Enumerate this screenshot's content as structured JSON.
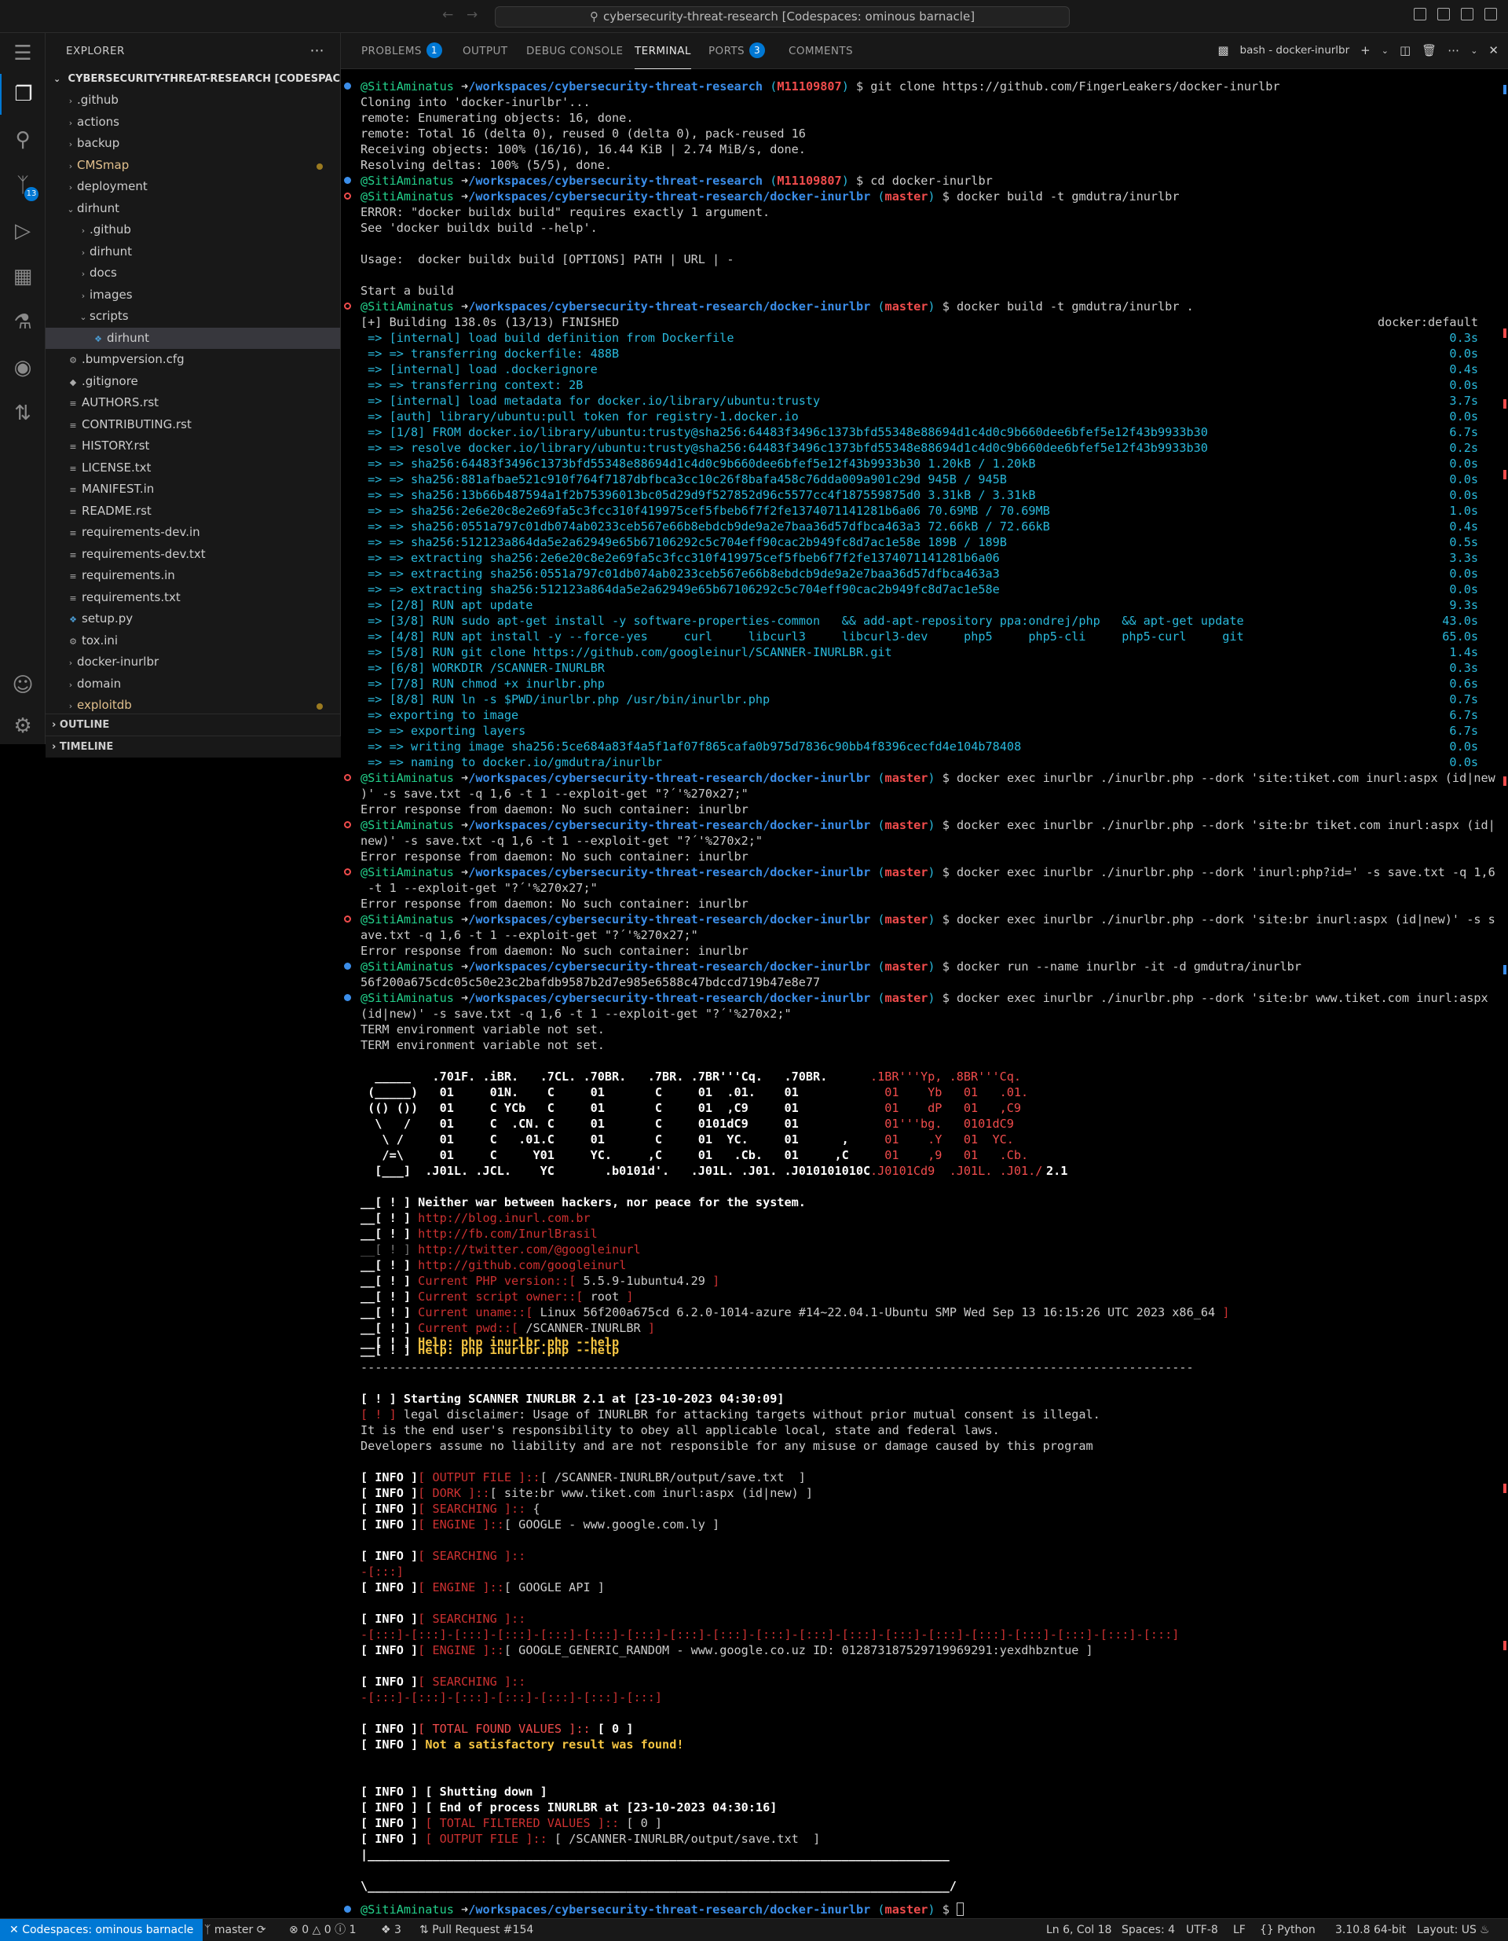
{
  "titlebar": {
    "search_text": "cybersecurity-threat-research [Codespaces: ominous barnacle]"
  },
  "activity": {
    "scm_badge": "13"
  },
  "explorer": {
    "header": "EXPLORER",
    "repo": "CYBERSECURITY-THREAT-RESEARCH [CODESPACES: OMINOUS BARNACLE]",
    "rows": [
      ".github",
      "actions",
      "backup",
      "CMSmap",
      "deployment",
      "dirhunt",
      ".github",
      "dirhunt",
      "docs",
      "images",
      "scripts",
      "dirhunt",
      ".bumpversion.cfg",
      ".gitignore",
      "AUTHORS.rst",
      "CONTRIBUTING.rst",
      "HISTORY.rst",
      "LICENSE.txt",
      "MANIFEST.in",
      "README.rst",
      "requirements-dev.in",
      "requirements-dev.txt",
      "requirements.in",
      "requirements.txt",
      "setup.py",
      "tox.ini",
      "docker-inurlbr",
      "domain",
      "exploitdb"
    ],
    "outline": "OUTLINE",
    "timeline": "TIMELINE"
  },
  "panel": {
    "tabs": [
      "PROBLEMS",
      "OUTPUT",
      "DEBUG CONSOLE",
      "TERMINAL",
      "PORTS",
      "COMMENTS"
    ],
    "problems_badge": "1",
    "ports_badge": "3",
    "terminal_name": "bash - docker-inurlbr"
  },
  "terminal": {
    "user": "@SitiAminatus",
    "arrow": "➜",
    "path_root": "/workspaces/cybersecurity-threat-research",
    "path_docker": "/workspaces/cybersecurity-threat-research/docker-inurlbr",
    "branch_main": "M11109807",
    "branch_master": "master",
    "cmd_clone": "$ git clone https://github.com/FingerLeakers/docker-inurlbr",
    "clone_out": [
      "Cloning into 'docker-inurlbr'...",
      "remote: Enumerating objects: 16, done.",
      "remote: Total 16 (delta 0), reused 0 (delta 0), pack-reused 16",
      "Receiving objects: 100% (16/16), 16.44 KiB | 2.74 MiB/s, done.",
      "Resolving deltas: 100% (5/5), done."
    ],
    "cmd_cd": "$ cd docker-inurlbr",
    "cmd_build1": "$ docker build -t gmdutra/inurlbr",
    "build1_out": [
      "ERROR: \"docker buildx build\" requires exactly 1 argument.",
      "See 'docker buildx build --help'.",
      "",
      "Usage:  docker buildx build [OPTIONS] PATH | URL | -",
      "",
      "Start a build"
    ],
    "cmd_build2": "$ docker build -t gmdutra/inurlbr .",
    "build_header": "[+] Building 138.0s (13/13) FINISHED",
    "build_ctx": "docker:default",
    "build_steps": [
      [
        " => [internal] load build definition from Dockerfile",
        "0.3s"
      ],
      [
        " => => transferring dockerfile: 488B",
        "0.0s"
      ],
      [
        " => [internal] load .dockerignore",
        "0.4s"
      ],
      [
        " => => transferring context: 2B",
        "0.0s"
      ],
      [
        " => [internal] load metadata for docker.io/library/ubuntu:trusty",
        "3.7s"
      ],
      [
        " => [auth] library/ubuntu:pull token for registry-1.docker.io",
        "0.0s"
      ],
      [
        " => [1/8] FROM docker.io/library/ubuntu:trusty@sha256:64483f3496c1373bfd55348e88694d1c4d0c9b660dee6bfef5e12f43b9933b30",
        "6.7s"
      ],
      [
        " => => resolve docker.io/library/ubuntu:trusty@sha256:64483f3496c1373bfd55348e88694d1c4d0c9b660dee6bfef5e12f43b9933b30",
        "0.2s"
      ],
      [
        " => => sha256:64483f3496c1373bfd55348e88694d1c4d0c9b660dee6bfef5e12f43b9933b30 1.20kB / 1.20kB",
        "0.0s"
      ],
      [
        " => => sha256:881afbae521c910f764f7187dbfbca3cc10c26f8bafa458c76dda009a901c29d 945B / 945B",
        "0.0s"
      ],
      [
        " => => sha256:13b66b487594a1f2b75396013bc05d29d9f527852d96c5577cc4f187559875d0 3.31kB / 3.31kB",
        "0.0s"
      ],
      [
        " => => sha256:2e6e20c8e2e69fa5c3fcc310f419975cef5fbeb6f7f2fe1374071141281b6a06 70.69MB / 70.69MB",
        "1.0s"
      ],
      [
        " => => sha256:0551a797c01db074ab0233ceb567e66b8ebdcb9de9a2e7baa36d57dfbca463a3 72.66kB / 72.66kB",
        "0.4s"
      ],
      [
        " => => sha256:512123a864da5e2a62949e65b67106292c5c704eff90cac2b949fc8d7ac1e58e 189B / 189B",
        "0.5s"
      ],
      [
        " => => extracting sha256:2e6e20c8e2e69fa5c3fcc310f419975cef5fbeb6f7f2fe1374071141281b6a06",
        "3.3s"
      ],
      [
        " => => extracting sha256:0551a797c01db074ab0233ceb567e66b8ebdcb9de9a2e7baa36d57dfbca463a3",
        "0.0s"
      ],
      [
        " => => extracting sha256:512123a864da5e2a62949e65b67106292c5c704eff90cac2b949fc8d7ac1e58e",
        "0.0s"
      ],
      [
        " => [2/8] RUN apt update",
        "9.3s"
      ],
      [
        " => [3/8] RUN sudo apt-get install -y software-properties-common   && add-apt-repository ppa:ondrej/php   && apt-get update",
        "43.0s"
      ],
      [
        " => [4/8] RUN apt install -y --force-yes     curl     libcurl3     libcurl3-dev     php5     php5-cli     php5-curl     git",
        "65.0s"
      ],
      [
        " => [5/8] RUN git clone https://github.com/googleinurl/SCANNER-INURLBR.git",
        "1.4s"
      ],
      [
        " => [6/8] WORKDIR /SCANNER-INURLBR",
        "0.3s"
      ],
      [
        " => [7/8] RUN chmod +x inurlbr.php",
        "0.6s"
      ],
      [
        " => [8/8] RUN ln -s $PWD/inurlbr.php /usr/bin/inurlbr.php",
        "0.7s"
      ],
      [
        " => exporting to image",
        "6.7s"
      ],
      [
        " => => exporting layers",
        "6.7s"
      ],
      [
        " => => writing image sha256:5ce684a83f4a5f1af07f865cafa0b975d7836c90bb4f8396cecfd4e104b78408",
        "0.0s"
      ],
      [
        " => => naming to docker.io/gmdutra/inurlbr",
        "0.0s"
      ]
    ],
    "exec1_a": "$ docker exec inurlbr ./inurlbr.php --dork 'site:tiket.com inurl:aspx (id|new",
    "exec1_b": ")' -s save.txt -q 1,6 -t 1 --exploit-get \"?´'%270x27;\"",
    "err": "Error response from daemon: No such container: inurlbr",
    "exec2_a": "$ docker exec inurlbr ./inurlbr.php --dork 'site:br tiket.com inurl:aspx (id|",
    "exec2_b": "new)' -s save.txt -q 1,6 -t 1 --exploit-get \"?´'%270x2;\"",
    "exec3_a": "$ docker exec inurlbr ./inurlbr.php --dork 'inurl:php?id=' -s save.txt -q 1,6",
    "exec3_b": " -t 1 --exploit-get \"?´'%270x27;\"",
    "exec4_a": "$ docker exec inurlbr ./inurlbr.php --dork 'site:br inurl:aspx (id|new)' -s s",
    "exec4_b": "ave.txt -q 1,6 -t 1 --exploit-get \"?´'%270x27;\"",
    "run_cmd": "$ docker run --name inurlbr -it -d gmdutra/inurlbr",
    "run_out": "56f200a675cdc05c50e23c2bafdb9587b2d7e985e6588c47bdccd719b47e8e77",
    "exec5_a": "$ docker exec inurlbr ./inurlbr.php --dork 'site:br www.tiket.com inurl:aspx",
    "exec5_b": "(id|new)' -s save.txt -q 1,6 -t 1 --exploit-get \"?´'%270x2;\"",
    "term_warn": "TERM environment variable not set.",
    "banner_white": [
      "  _____   .701F. .iBR.   .7CL. .70BR.   .7BR. .7BR'''Cq.   .70BR.",
      " (_____)   01     01N.    C     01       C     01  .01.    01",
      " (() ())   01     C YCb   C     01       C     01  ,C9     01",
      "  \\   /    01     C  .CN. C     01       C     0101dC9     01",
      "   \\ /     01     C   .01.C     01       C     01  YC.     01      ,",
      "   /=\\     01     C     Y01     YC.     ,C     01   .Cb.   01     ,C",
      "  [___]  .J01L. .JCL.    YC       .b0101d'.   .J01L. .J01. .J010101010C"
    ],
    "banner_red": [
      ".1BR'''Yp, .8BR'''Cq.",
      "  01    Yb   01   .01.",
      "  01    dP   01   ,C9",
      "  01'''bg.   0101dC9",
      "  01    .Y   01  YC.",
      "  01    ,9   01   .Cb.",
      ".J0101Cd9  .J01L. .J01./"
    ],
    "banner_ver": "2.1",
    "tag": "__[ ! ]",
    "slogan": "Neither war between hackers, nor peace for the system.",
    "links": [
      "http://blog.inurl.com.br",
      "http://fb.com/InurlBrasil",
      "http://twitter.com/@googleinurl",
      "http://github.com/googleinurl"
    ],
    "php_label": "Current PHP version::[",
    "php_val": "5.5.9-1ubuntu4.29",
    "owner_label": "Current script owner::[",
    "owner_val": "root",
    "uname_label": "Current uname::[",
    "uname_val": "Linux 56f200a675cd 6.2.0-1014-azure #14~22.04.1-Ubuntu SMP Wed Sep 13 16:15:26 UTC 2023 x86_64",
    "pwd_label": "Current pwd::[",
    "pwd_val": "/SCANNER-INURLBR",
    "help1": "Help: php inurlbr.php --help",
    "help2": "Help: php inurlbr.php --help",
    "close_br": "]",
    "dash_line": "--------------------------------------------------------------------------------------------------------------------",
    "starting": "[ ! ] Starting SCANNER INURLBR 2.1 at [23-10-2023 04:30:09]",
    "disc1_tag": "[ ! ]",
    "disc1": "legal disclaimer: Usage of INURLBR for attacking targets without prior mutual consent is illegal.",
    "disc2": "It is the end user's responsibility to obey all applicable local, state and federal laws.",
    "disc3": "Developers assume no liability and are not responsible for any misuse or damage caused by this program",
    "info_tag": "[ INFO ]",
    "out_file_label": "[ OUTPUT FILE ]::",
    "out_file_val": "[ /SCANNER-INURLBR/output/save.txt  ]",
    "dork_label": "[ DORK ]::",
    "dork_val": "[ site:br www.tiket.com inurl:aspx (id|new) ]",
    "searching_label": "[ SEARCHING ]::",
    "searching_brace": " {",
    "engine_label": "[ ENGINE ]::",
    "engine1": "[ GOOGLE - www.google.com.ly ]",
    "progress1": "-[:::]",
    "engine2": "[ GOOGLE API ]",
    "progress2": "-[:::]-[:::]-[:::]-[:::]-[:::]-[:::]-[:::]-[:::]-[:::]-[:::]-[:::]-[:::]-[:::]-[:::]-[:::]-[:::]-[:::]-[:::]-[:::]",
    "engine3": "[ GOOGLE_GENERIC_RANDOM - www.google.co.uz ID: 012873187529719969291:yexdhbzntue ]",
    "progress3": "-[:::]-[:::]-[:::]-[:::]-[:::]-[:::]-[:::]",
    "total_label": "[ TOTAL FOUND VALUES ]::",
    "total_val": "[ 0 ]",
    "not_found": "Not a satisfactory result was found!",
    "shutdown": "[ Shutting down ]",
    "end_proc": "[ End of process INURLBR at [23-10-2023 04:30:16]",
    "filtered_label": "[ TOTAL FILTERED VALUES ]::",
    "filtered_val": "[ 0 ]",
    "out_file2_label": "[ OUTPUT FILE ]::",
    "out_file2_val": "[ /SCANNER-INURLBR/output/save.txt  ]",
    "box_top": "|_________________________________________________________________________________",
    "box_bottom": "\\_________________________________________________________________________________/",
    "prompt_end": "$"
  },
  "statusbar": {
    "remote": "Codespaces: ominous barnacle",
    "branch": "master",
    "errors": "0",
    "warnings": "0",
    "info": "1",
    "ports": "3",
    "pr": "Pull Request #154",
    "position": "Ln 6, Col 18",
    "spaces": "Spaces: 4",
    "encoding": "UTF-8",
    "eol": "LF",
    "language": "Python",
    "interpreter": "3.10.8 64-bit",
    "layout": "Layout: US"
  }
}
